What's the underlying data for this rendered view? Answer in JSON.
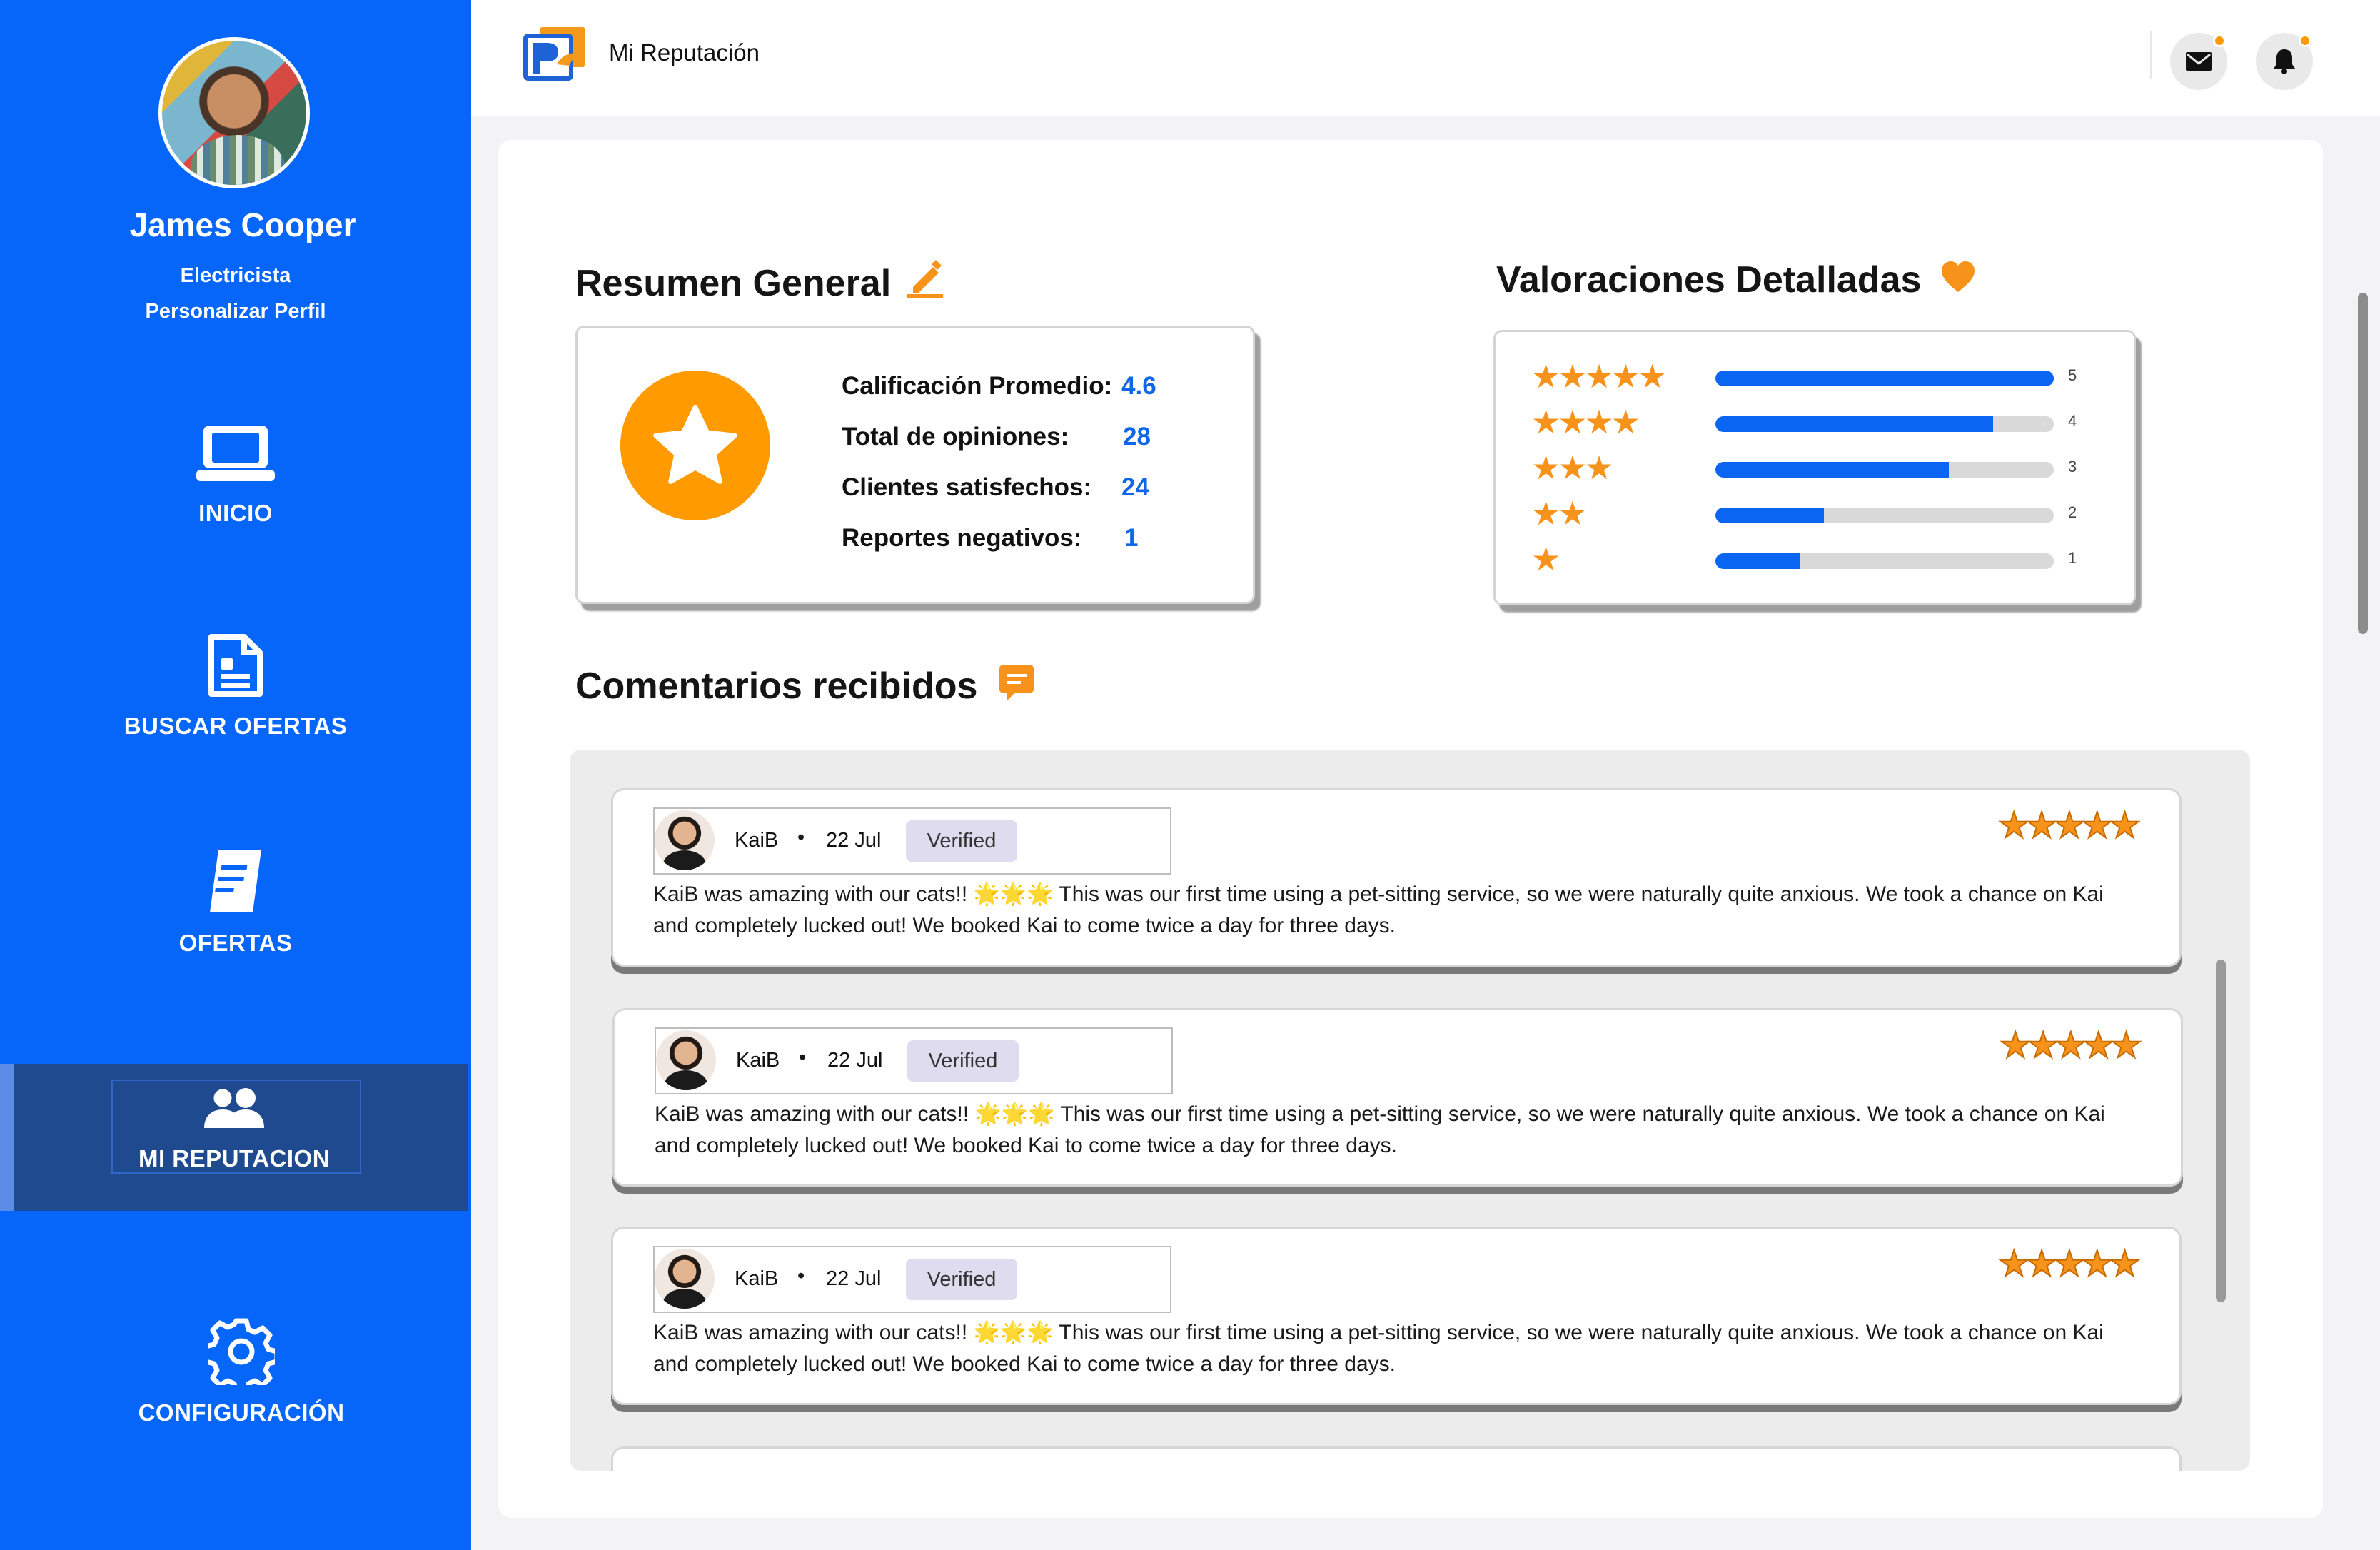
{
  "sidebar": {
    "user_name": "James Cooper",
    "user_role": "Electricista",
    "profile_link": "Personalizar Perfil",
    "nav": [
      {
        "label": "INICIO",
        "icon": "laptop-icon"
      },
      {
        "label": "BUSCAR OFERTAS",
        "icon": "document-icon"
      },
      {
        "label": "OFERTAS",
        "icon": "offers-icon"
      },
      {
        "label": "MI REPUTACION",
        "icon": "users-icon",
        "active": true
      },
      {
        "label": "CONFIGURACIÓN",
        "icon": "gear-icon"
      }
    ]
  },
  "header": {
    "title": "Mi Reputación",
    "icons": [
      "mail-icon",
      "bell-icon"
    ],
    "accent": "#ff9900"
  },
  "summary": {
    "title": "Resumen General",
    "rows": [
      {
        "label": "Calificación Promedio:",
        "value": "4.6"
      },
      {
        "label": "Total de opiniones:",
        "value": "28"
      },
      {
        "label": "Clientes satisfechos:",
        "value": "24"
      },
      {
        "label": "Reportes negativos:",
        "value": "1"
      }
    ]
  },
  "ratings": {
    "title": "Valoraciones Detalladas",
    "rows": [
      {
        "stars": "★★★★★",
        "label": "5",
        "fraction": 1.0
      },
      {
        "stars": "★★★★",
        "label": "4",
        "fraction": 0.82
      },
      {
        "stars": "★★★",
        "label": "3",
        "fraction": 0.69
      },
      {
        "stars": "★★",
        "label": "2",
        "fraction": 0.32
      },
      {
        "stars": "★",
        "label": "1",
        "fraction": 0.25
      }
    ]
  },
  "comments": {
    "title": "Comentarios recibidos",
    "items": [
      {
        "name": "KaiB",
        "date": "22 Jul",
        "badge": "Verified",
        "stars": "★★★★★",
        "text": "KaiB was amazing with our cats!! 🌟🌟🌟 This was our first time using a pet-sitting service, so we were naturally quite anxious. We took a chance on Kai and completely lucked out! We booked Kai to come twice a day for three days."
      },
      {
        "name": "KaiB",
        "date": "22 Jul",
        "badge": "Verified",
        "stars": "★★★★★",
        "text": "KaiB was amazing with our cats!! 🌟🌟🌟 This was our first time using a pet-sitting service, so we were naturally quite anxious. We took a chance on Kai and completely lucked out! We booked Kai to come twice a day for three days."
      },
      {
        "name": "KaiB",
        "date": "22 Jul",
        "badge": "Verified",
        "stars": "★★★★★",
        "text": "KaiB was amazing with our cats!! 🌟🌟🌟 This was our first time using a pet-sitting service, so we were naturally quite anxious. We took a chance on Kai and completely lucked out! We booked Kai to come twice a day for three days."
      }
    ]
  },
  "colors": {
    "sidebar": "#0666fa",
    "active_nav": "#1f4a8f",
    "star": "#f7931a",
    "bar": "#0a66f2",
    "value": "#0e67e8"
  }
}
